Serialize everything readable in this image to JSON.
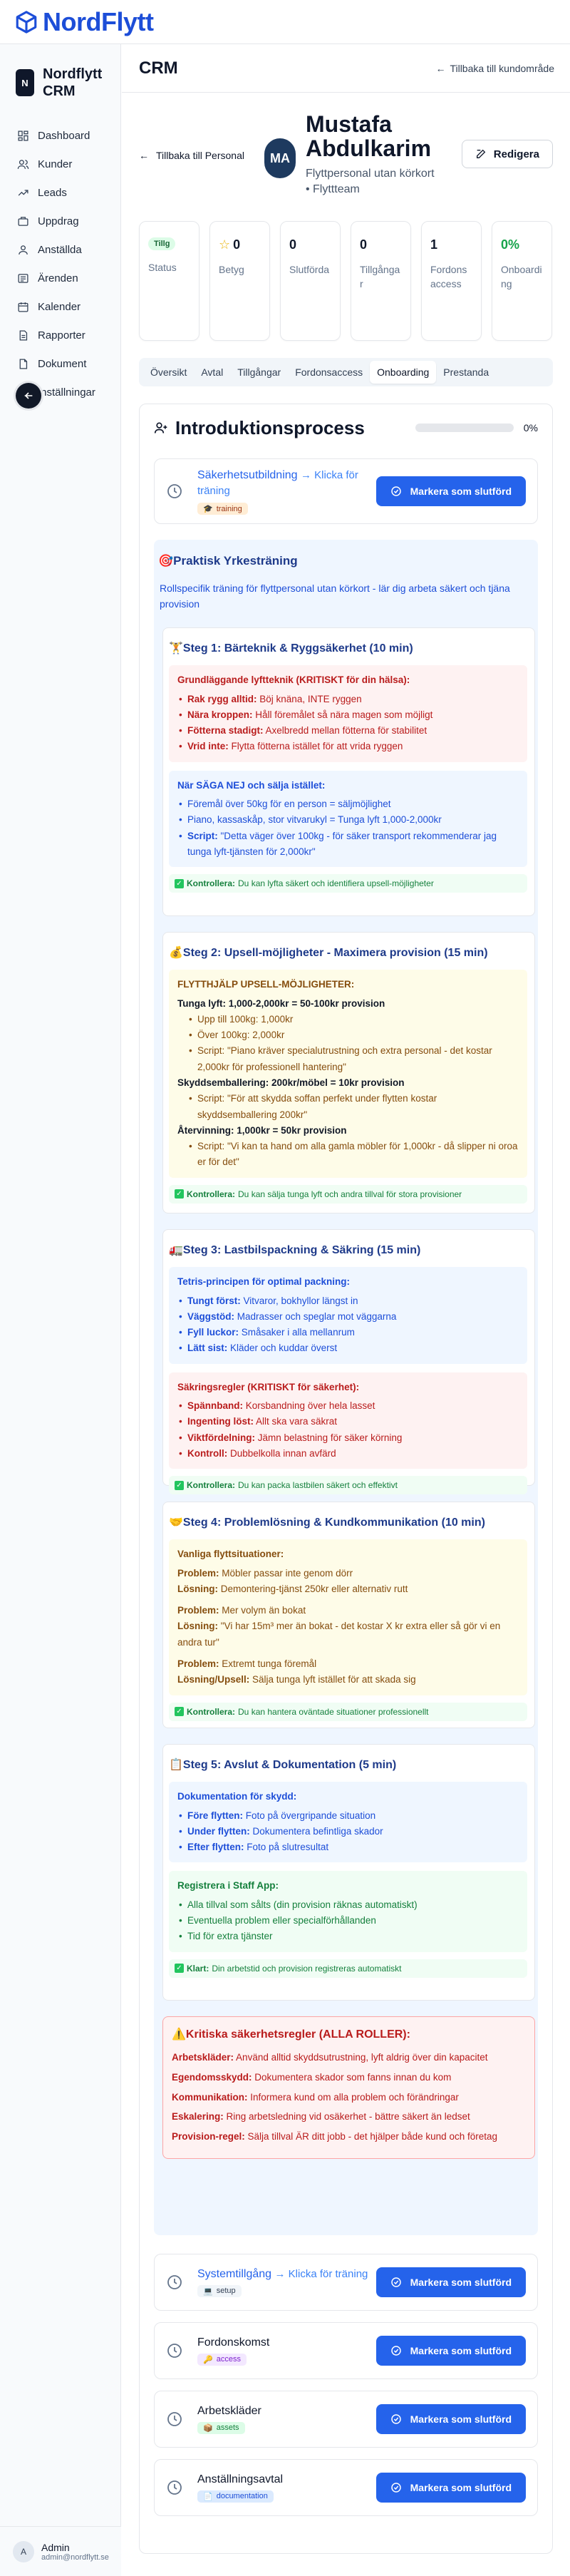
{
  "brand": {
    "name": "NordFlytt"
  },
  "sidebar": {
    "logo_letter": "N",
    "title": "Nordflytt CRM",
    "items": [
      {
        "label": "Dashboard",
        "icon": "dashboard-icon"
      },
      {
        "label": "Kunder",
        "icon": "users-icon"
      },
      {
        "label": "Leads",
        "icon": "trending-icon"
      },
      {
        "label": "Uppdrag",
        "icon": "briefcase-icon"
      },
      {
        "label": "Anställda",
        "icon": "employees-icon"
      },
      {
        "label": "Ärenden",
        "icon": "tickets-icon"
      },
      {
        "label": "Kalender",
        "icon": "calendar-icon"
      },
      {
        "label": "Rapporter",
        "icon": "reports-icon"
      },
      {
        "label": "Dokument",
        "icon": "document-icon"
      },
      {
        "label": "Inställningar",
        "icon": "settings-icon"
      }
    ],
    "user": {
      "initial": "A",
      "name": "Admin",
      "email": "admin@nordflytt.se"
    }
  },
  "header": {
    "title": "CRM",
    "back_label": "Tillbaka till kundområde"
  },
  "profile": {
    "back_label": "Tillbaka till Personal",
    "initials": "MA",
    "name": "Mustafa Abdulkarim",
    "role": "Flyttpersonal utan körkort • Flyttteam",
    "edit_label": "Redigera"
  },
  "stats": [
    {
      "value": "Tillg",
      "label": "Status",
      "kind": "badge"
    },
    {
      "value": "0",
      "label": "Betyg",
      "kind": "star"
    },
    {
      "value": "0",
      "label": "Slutförda",
      "kind": "plain"
    },
    {
      "value": "0",
      "label": "Tillgångar",
      "kind": "plain"
    },
    {
      "value": "1",
      "label": "Fordonsaccess",
      "kind": "plain"
    },
    {
      "value": "0%",
      "label": "Onboarding",
      "kind": "green"
    }
  ],
  "tabs": [
    "Översikt",
    "Avtal",
    "Tillgångar",
    "Fordonsaccess",
    "Onboarding",
    "Prestanda"
  ],
  "active_tab": "Onboarding",
  "onboarding": {
    "title": "Introduktionsprocess",
    "progress_pct": 0,
    "progress_label": "0%",
    "mark_label": "Markera som slutförd",
    "hint": "→ Klicka för träning",
    "task_safety": {
      "title": "Säkerhetsutbildning",
      "tag": "training"
    },
    "practical": {
      "title": "🎯Praktisk Yrkesträning",
      "desc": "Rollspecifik träning för flyttpersonal utan körkort - lär dig arbeta säkert och tjäna provision",
      "step1": {
        "title": "🏋️Steg 1: Bärteknik & Ryggsäkerhet (10 min)",
        "red_title": "Grundläggande lyftteknik (KRITISKT för din hälsa):",
        "red_items": [
          {
            "b": "Rak rygg alltid:",
            "t": " Böj knäna, INTE ryggen"
          },
          {
            "b": "Nära kroppen:",
            "t": " Håll föremålet så nära magen som möjligt"
          },
          {
            "b": "Fötterna stadigt:",
            "t": " Axelbredd mellan fötterna för stabilitet"
          },
          {
            "b": "Vrid inte:",
            "t": " Flytta fötterna istället för att vrida ryggen"
          }
        ],
        "blue_title": "När SÄGA NEJ och sälja istället:",
        "blue_items": [
          {
            "b": "",
            "t": "Föremål över 50kg för en person = säljmöjlighet"
          },
          {
            "b": "",
            "t": "Piano, kassaskåp, stor vitvarukyl = Tunga lyft 1,000-2,000kr"
          },
          {
            "b": "Script:",
            "t": " \"Detta väger över 100kg - för säker transport rekommenderar jag tunga lyft-tjänsten för 2,000kr\""
          }
        ],
        "check_b": "Kontrollera:",
        "check_t": " Du kan lyfta säkert och identifiera upsell-möjligheter"
      },
      "step2": {
        "title": "💰Steg 2: Upsell-möjligheter - Maximera provision (15 min)",
        "y_title": "FLYTTHJÄLP UPSELL-MÖJLIGHETER:",
        "heavy": "Tunga lyft: 1,000-2,000kr = 50-100kr provision",
        "heavy_items": [
          "Upp till 100kg: 1,000kr",
          "Över 100kg: 2,000kr",
          "Script: \"Piano kräver specialutrustning och extra personal - det kostar 2,000kr för professionell hantering\""
        ],
        "pack": "Skyddsemballering: 200kr/möbel = 10kr provision",
        "pack_items": [
          "Script: \"För att skydda soffan perfekt under flytten kostar skyddsemballering 200kr\""
        ],
        "recycle": "Återvinning: 1,000kr = 50kr provision",
        "recycle_items": [
          "Script: \"Vi kan ta hand om alla gamla möbler för 1,000kr - då slipper ni oroa er för det\""
        ],
        "check_b": "Kontrollera:",
        "check_t": " Du kan sälja tunga lyft och andra tillval för stora provisioner"
      },
      "step3": {
        "title": "🚛Steg 3: Lastbilspackning & Säkring (15 min)",
        "blue_title": "Tetris-principen för optimal packning:",
        "blue_items": [
          {
            "b": "Tungt först:",
            "t": " Vitvaror, bokhyllor längst in"
          },
          {
            "b": "Väggstöd:",
            "t": " Madrasser och speglar mot väggarna"
          },
          {
            "b": "Fyll luckor:",
            "t": " Småsaker i alla mellanrum"
          },
          {
            "b": "Lätt sist:",
            "t": " Kläder och kuddar överst"
          }
        ],
        "red_title": "Säkringsregler (KRITISKT för säkerhet):",
        "red_items": [
          {
            "b": "Spännband:",
            "t": " Korsbandning över hela lasset"
          },
          {
            "b": "Ingenting löst:",
            "t": " Allt ska vara säkrat"
          },
          {
            "b": "Viktfördelning:",
            "t": " Jämn belastning för säker körning"
          },
          {
            "b": "Kontroll:",
            "t": " Dubbelkolla innan avfärd"
          }
        ],
        "check_b": "Kontrollera:",
        "check_t": " Du kan packa lastbilen säkert och effektivt"
      },
      "step4": {
        "title": "🤝Steg 4: Problemlösning & Kundkommunikation (10 min)",
        "y_title": "Vanliga flyttsituationer:",
        "cases": [
          {
            "p": "Möbler passar inte genom dörr",
            "l_label": "Lösning:",
            "l": "Demontering-tjänst 250kr eller alternativ rutt"
          },
          {
            "p": "Mer volym än bokat",
            "l_label": "Lösning:",
            "l": "\"Vi har 15m³ mer än bokat - det kostar X kr extra eller så gör vi en andra tur\""
          },
          {
            "p": "Extremt tunga föremål",
            "l_label": "Lösning/Upsell:",
            "l": "Sälja tunga lyft istället för att skada sig"
          }
        ],
        "problem_label": "Problem:",
        "check_b": "Kontrollera:",
        "check_t": " Du kan hantera oväntade situationer professionellt"
      },
      "step5": {
        "title": "📋Steg 5: Avslut & Dokumentation (5 min)",
        "blue_title": "Dokumentation för skydd:",
        "blue_items": [
          {
            "b": "Före flytten:",
            "t": " Foto på övergripande situation"
          },
          {
            "b": "Under flytten:",
            "t": " Dokumentera befintliga skador"
          },
          {
            "b": "Efter flytten:",
            "t": " Foto på slutresultat"
          }
        ],
        "green_title": "Registrera i Staff App:",
        "green_items": [
          "Alla tillval som sålts (din provision räknas automatiskt)",
          "Eventuella problem eller specialförhållanden",
          "Tid för extra tjänster"
        ],
        "check_b": "Klart:",
        "check_t": " Din arbetstid och provision registreras automatiskt"
      },
      "safety": {
        "title": "⚠️Kritiska säkerhetsregler (ALLA ROLLER):",
        "rules": [
          {
            "b": "Arbetskläder:",
            "t": " Använd alltid skyddsutrustning, lyft aldrig över din kapacitet"
          },
          {
            "b": "Egendomsskydd:",
            "t": " Dokumentera skador som fanns innan du kom"
          },
          {
            "b": "Kommunikation:",
            "t": " Informera kund om alla problem och förändringar"
          },
          {
            "b": "Eskalering:",
            "t": " Ring arbetsledning vid osäkerhet - bättre säkert än ledset"
          },
          {
            "b": "Provision-regel:",
            "t": " Sälja tillval ÄR ditt jobb - det hjälper både kund och företag"
          }
        ]
      }
    },
    "tasks": [
      {
        "title": "Systemtillgång",
        "hint": "→ Klicka för träning",
        "tag": "setup",
        "tag_icon": "laptop-icon"
      },
      {
        "title": "Fordonskomst",
        "hint": "",
        "tag": "access",
        "tag_icon": "key-icon"
      },
      {
        "title": "Arbetskläder",
        "hint": "",
        "tag": "assets",
        "tag_icon": "package-icon"
      },
      {
        "title": "Anställningsavtal",
        "hint": "",
        "tag": "documentation",
        "tag_icon": "file-icon"
      }
    ]
  }
}
